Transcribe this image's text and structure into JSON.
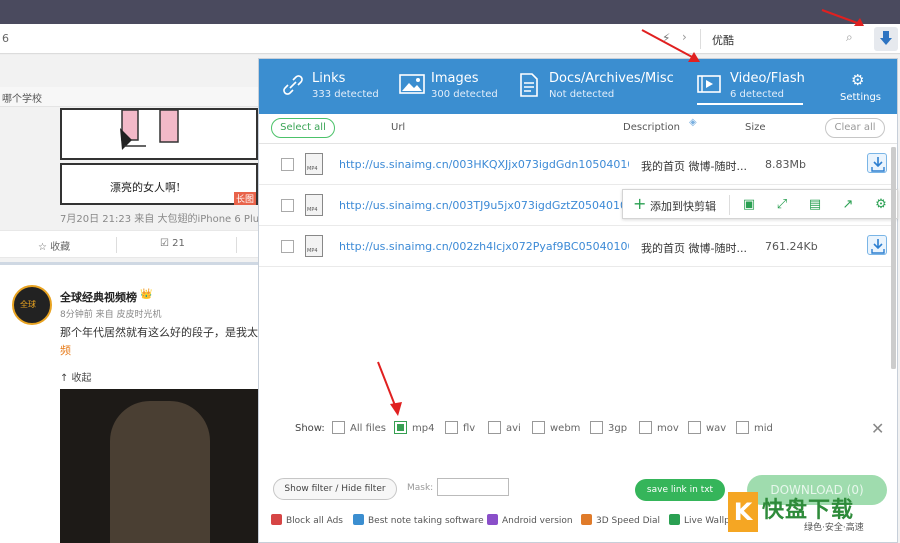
{
  "browser": {
    "address_left": "6",
    "search_text": "优酷",
    "bolt": "⚡",
    "arrow": "›"
  },
  "page": {
    "school_text": "哪个学校",
    "card_caption": "漂亮的女人啊!",
    "long_tag": "长图",
    "meta": "7月20日 21:23 来自 大包翅的iPhone 6 Plus",
    "fav_label": "☆ 收藏",
    "fwd_label": "☑ 21",
    "avatar_text": "全球",
    "poster_name": "全球经典视频榜",
    "poster_badge": "👑",
    "post_time": "8分钟前 来自 皮皮时光机",
    "post_text": "那个年代居然就有这么好的段子，是我太",
    "post_more": "频",
    "collapse_label": "↑ 收起"
  },
  "tabs": [
    {
      "title": "Links",
      "sub": "333 detected"
    },
    {
      "title": "Images",
      "sub": "300 detected"
    },
    {
      "title": "Docs/Archives/Misc",
      "sub": "Not detected"
    },
    {
      "title": "Video/Flash",
      "sub": "6 detected"
    }
  ],
  "settings_label": "Settings",
  "columns": {
    "select_all": "Select all",
    "url": "Url",
    "description": "Description",
    "size": "Size",
    "clear_all": "Clear all"
  },
  "rows": [
    {
      "type": "MP4",
      "url": "http://us.sinaimg.cn/003HKQXJjx073igdGdn105040100...",
      "desc": "我的首页 微博-随时...",
      "size": "8.83Mb"
    },
    {
      "type": "MP4",
      "url": "http://us.sinaimg.cn/003TJ9u5jx073igdGztZ05040100F...",
      "desc": "",
      "size": ""
    },
    {
      "type": "MP4",
      "url": "http://us.sinaimg.cn/002zh4lcjx072Pyaf9BC050401003...",
      "desc": "我的首页 微博-随时...",
      "size": "761.24Kb"
    }
  ],
  "quickbar": {
    "plus": "+",
    "label": "添加到快剪辑"
  },
  "show": {
    "label": "Show:",
    "types": [
      {
        "label": "All files",
        "checked": false
      },
      {
        "label": "mp4",
        "checked": true
      },
      {
        "label": "flv",
        "checked": false
      },
      {
        "label": "avi",
        "checked": false
      },
      {
        "label": "webm",
        "checked": false
      },
      {
        "label": "3gp",
        "checked": false
      },
      {
        "label": "mov",
        "checked": false
      },
      {
        "label": "wav",
        "checked": false
      },
      {
        "label": "mid",
        "checked": false
      }
    ],
    "close": "✕"
  },
  "filter": {
    "toggle_label": "Show filter / Hide filter",
    "mask_label": "Mask:",
    "mask_value": "",
    "save_label": "save link in txt",
    "download_label": "DOWNLOAD (0)"
  },
  "promos": [
    {
      "label": "Block all Ads",
      "color": "#d64545"
    },
    {
      "label": "Best note taking software",
      "color": "#3b8ed0"
    },
    {
      "label": "Android version",
      "color": "#8a4fc9"
    },
    {
      "label": "3D Speed Dial",
      "color": "#e07b2a"
    },
    {
      "label": "Live Wallp",
      "color": "#2aa052"
    }
  ],
  "watermark": {
    "k": "K",
    "text": "快盘下载",
    "sub": "绿色·安全·高速"
  },
  "colors": {
    "header": "#3b8ed0",
    "accent_green": "#35b55a",
    "link": "#3c8ad6",
    "arrow_red": "#e02020"
  }
}
